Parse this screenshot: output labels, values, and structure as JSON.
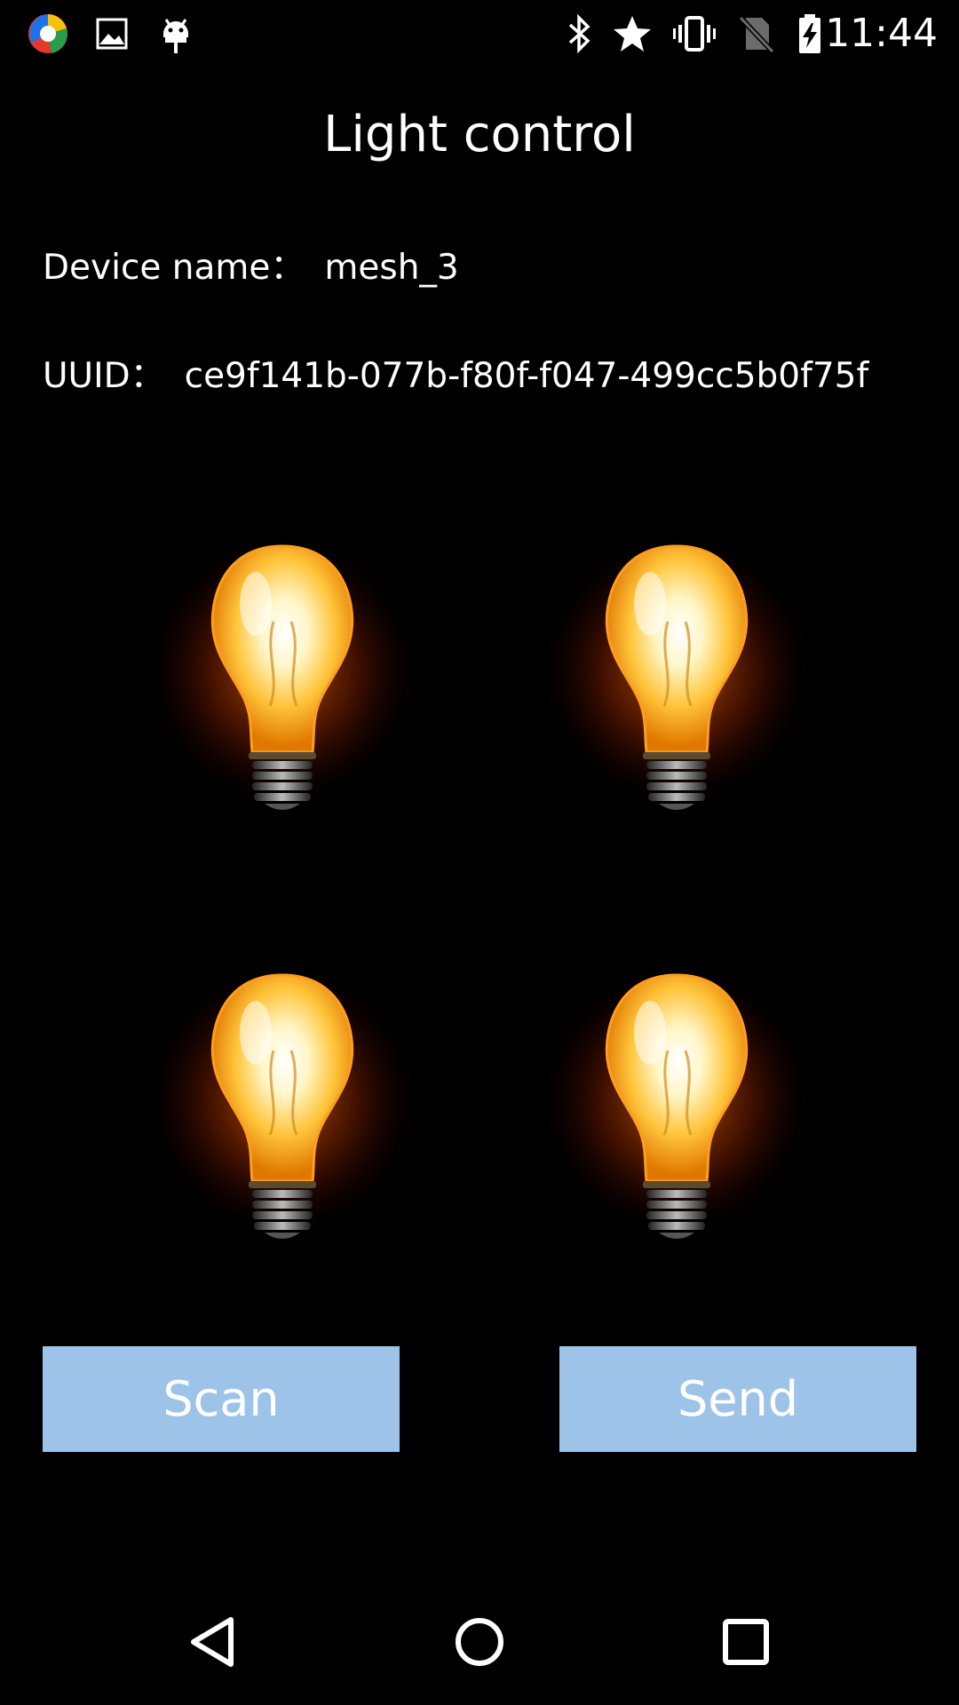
{
  "status_bar": {
    "time": "11:44",
    "left_icons": [
      "chrome-like-app-icon",
      "gallery-icon",
      "android-debug-icon"
    ],
    "right_icons": [
      "bluetooth-icon",
      "star-icon",
      "vibrate-icon",
      "no-sim-icon",
      "battery-charging-icon"
    ]
  },
  "header": {
    "title": "Light control"
  },
  "device": {
    "name_label": "Device name：",
    "name_value": "mesh_3",
    "uuid_label": "UUID：",
    "uuid_value": "ce9f141b-077b-f80f-f047-499cc5b0f75f"
  },
  "lights": [
    {
      "id": 1,
      "state": "on"
    },
    {
      "id": 2,
      "state": "on"
    },
    {
      "id": 3,
      "state": "on"
    },
    {
      "id": 4,
      "state": "on"
    }
  ],
  "actions": {
    "scan_label": "Scan",
    "send_label": "Send"
  },
  "nav_bar": {
    "icons": [
      "back-icon",
      "home-icon",
      "recents-icon"
    ]
  },
  "colors": {
    "background": "#000000",
    "button": "#9dc3e8",
    "text": "#ffffff",
    "bulb_glow": "#ffb000"
  }
}
